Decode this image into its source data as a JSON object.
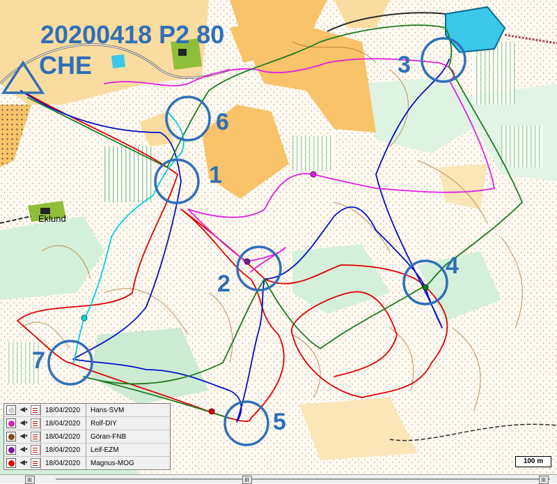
{
  "map": {
    "title_line1": "20200418 P2 80",
    "title_line2": "CHE",
    "place_name": "Eklund",
    "start_icon": "triangle-start-icon",
    "controls": [
      {
        "label": "1"
      },
      {
        "label": "2"
      },
      {
        "label": "3"
      },
      {
        "label": "4"
      },
      {
        "label": "5"
      },
      {
        "label": "6"
      },
      {
        "label": "7"
      }
    ],
    "scale_label": "100 m",
    "colors": {
      "route_red": "#e00000",
      "route_blue": "#0010c8",
      "route_magenta": "#e020e0",
      "route_green": "#1a7a1a",
      "route_cyan": "#00d0e0",
      "control_circle": "#2f6fb8",
      "open_land": "#f9c36a",
      "vegetation": "#c6ecd0",
      "water": "#3cc8e8"
    }
  },
  "legend": {
    "rows": [
      {
        "date": "18/04/2020",
        "name": "Hans-SVM",
        "color": "#d0d0d0",
        "control_icon": "arrow-control-icon",
        "list_icon": "split-list-icon"
      },
      {
        "date": "18/04/2020",
        "name": "Rolf-DIY",
        "color": "#e020b0",
        "control_icon": "arrow-control-icon",
        "list_icon": "split-list-icon"
      },
      {
        "date": "18/04/2020",
        "name": "Göran-FNB",
        "color": "#8a4a10",
        "control_icon": "arrow-control-icon",
        "list_icon": "split-list-icon"
      },
      {
        "date": "18/04/2020",
        "name": "Leif-EZM",
        "color": "#7a1aa0",
        "control_icon": "arrow-control-icon",
        "list_icon": "split-list-icon"
      },
      {
        "date": "18/04/2020",
        "name": "Magnus-MOG",
        "color": "#e00000",
        "control_icon": "arrow-control-icon",
        "list_icon": "split-list-icon"
      }
    ]
  }
}
